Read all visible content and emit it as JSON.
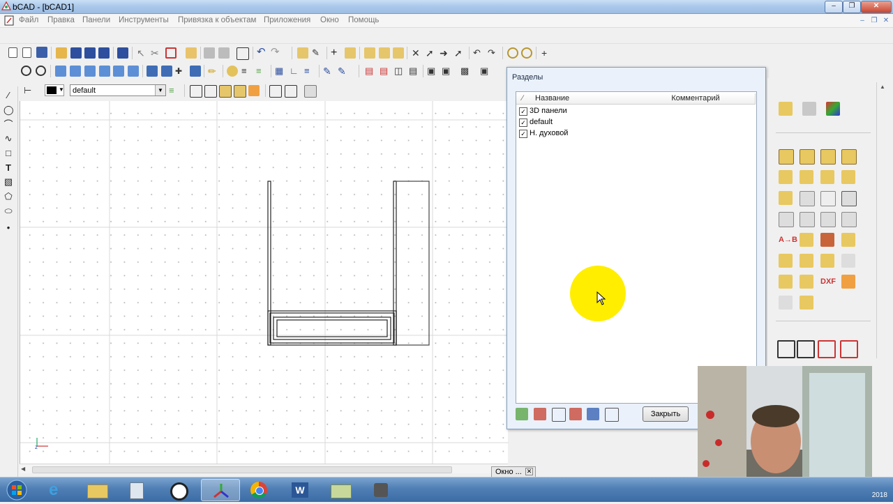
{
  "window": {
    "title": "bCAD - [bCAD1]"
  },
  "menu": {
    "items": [
      "Файл",
      "Правка",
      "Панели",
      "Инструменты",
      "Привязка к объектам",
      "Приложения",
      "Окно",
      "Помощь"
    ]
  },
  "properties_bar": {
    "layer_value": "default"
  },
  "dialog": {
    "title": "Разделы",
    "columns": [
      "Название",
      "Комментарий"
    ],
    "rows": [
      {
        "name": "3D панели",
        "checked": true
      },
      {
        "name": "default",
        "checked": true
      },
      {
        "name": "Н. духовой",
        "checked": true
      }
    ],
    "close_label": "Закрыть"
  },
  "window_tab": {
    "label": "Окно ..."
  },
  "taskbar": {
    "clock_fragment": "2018"
  },
  "colors": {
    "titlebar": "#a9c7ea",
    "taskbar": "#3b6ca5",
    "cursor_highlight": "#ffee00"
  }
}
